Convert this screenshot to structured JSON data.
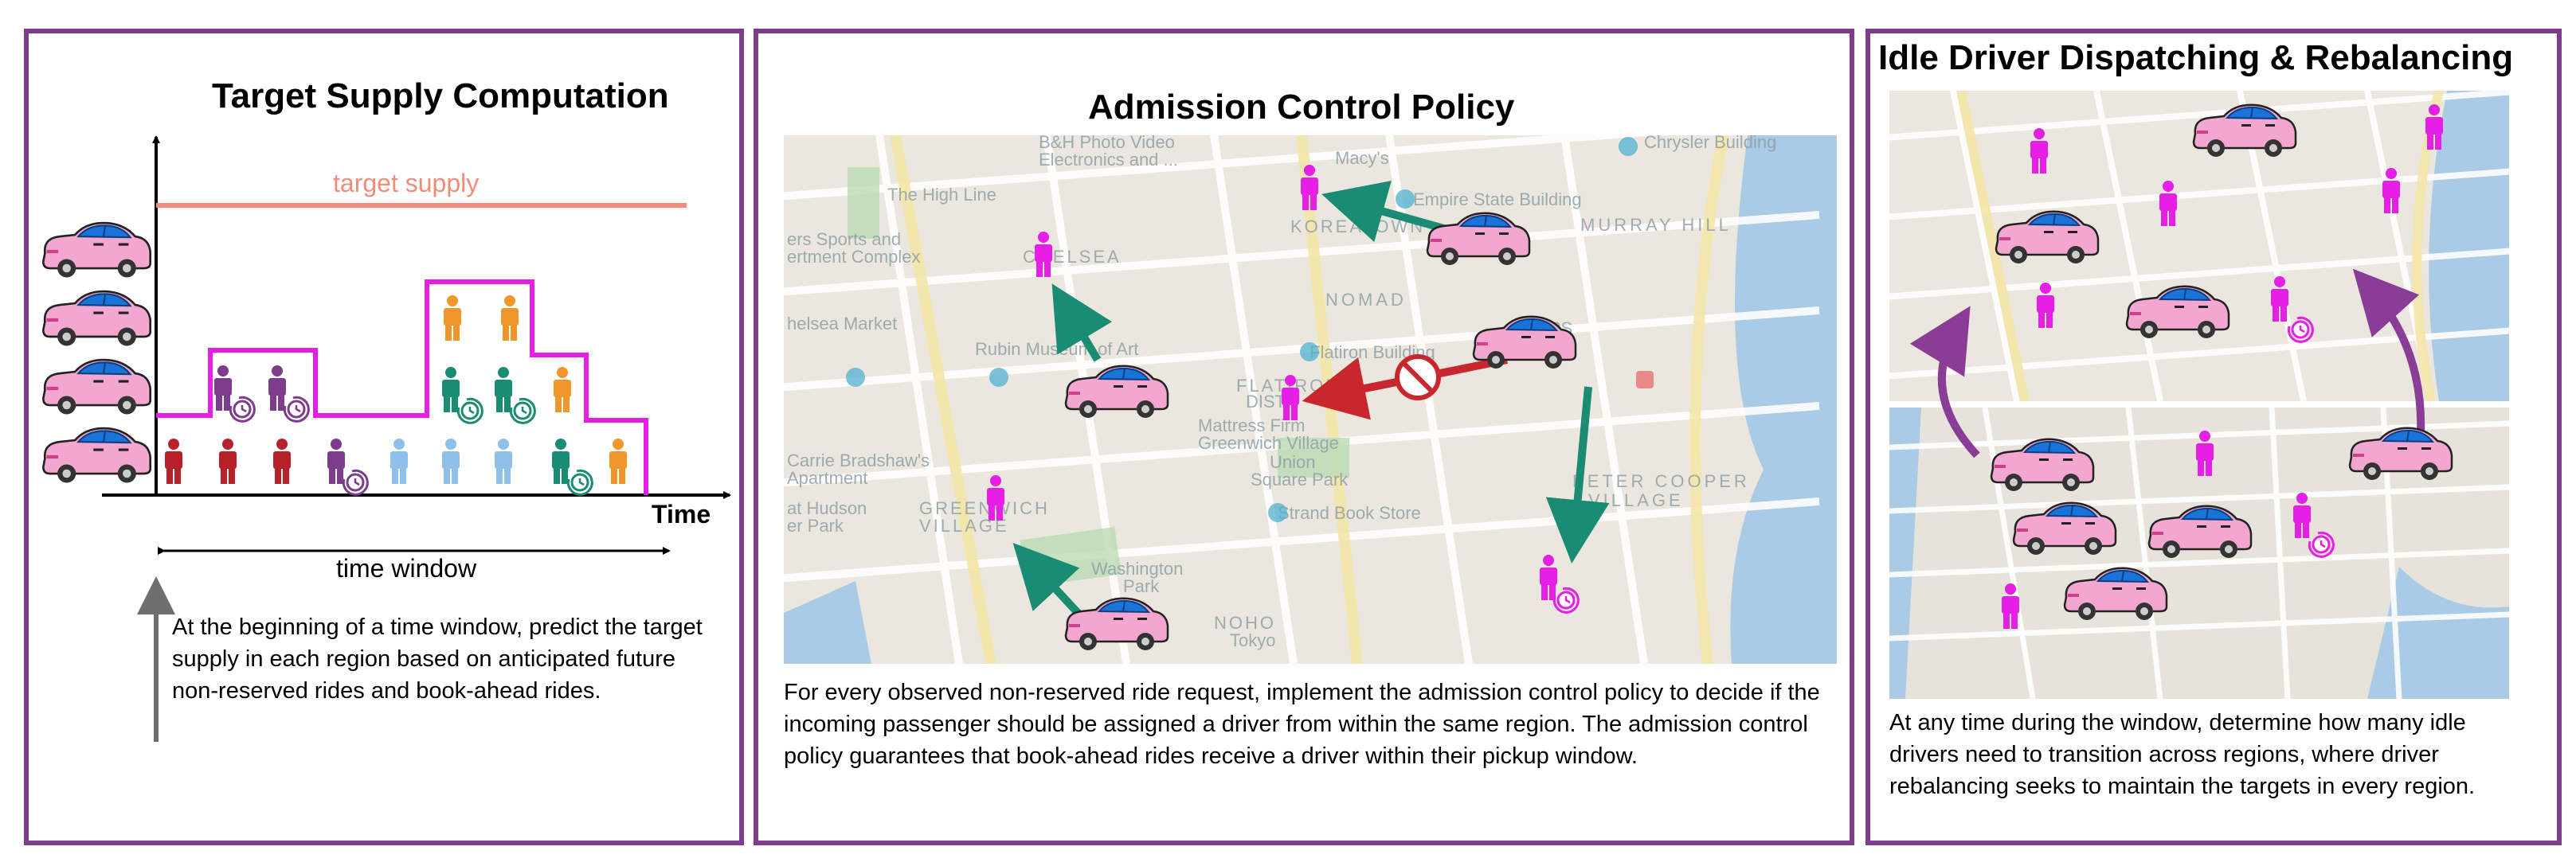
{
  "panels": {
    "target_supply": {
      "title": "Target Supply Computation",
      "target_label": "target supply",
      "time_label": "Time",
      "window_label": "time window",
      "description": "At the beginning of a time window, predict the target supply in each region based on anticipated future non-reserved rides and book-ahead rides."
    },
    "admission": {
      "title": "Admission Control Policy",
      "description": "For every observed non-reserved ride request, implement the admission control policy to decide if the incoming passenger should be assigned a driver from within the same region. The admission control policy guarantees that book-ahead rides receive a driver within their pickup window."
    },
    "dispatch": {
      "title": "Idle Driver Dispatching & Rebalancing",
      "description": "At any time during the window, determine how many idle drivers need to transition across regions, where driver rebalancing seeks to maintain the targets in every region."
    }
  },
  "map_labels": [
    "B&H Photo Video",
    "Electronics and ...",
    "Macy's",
    "Empire State Building",
    "Chrysler Building",
    "The High Line",
    "KOREATOWN",
    "MURRAY HILL",
    "ers Sports and",
    "ertment Complex",
    "CHELSEA",
    "NOMAD",
    "helsea Market",
    "Rubin Museum of Art",
    "Flatiron Building",
    "FLATIRON",
    "DISTR",
    "KIPS",
    "Mattress Firm",
    "Greenwich Village",
    "Union",
    "Square Park",
    "Carrie Bradshaw's",
    "Apartment",
    "GREENWICH",
    "VILLAGE",
    "Strand Book Store",
    "PETER COOPER",
    "VILLAGE",
    "at Hudson",
    "er Park",
    "Washington",
    "Park",
    "NOHO",
    "Tokyo"
  ],
  "colors": {
    "panel_border": "#7d3c8c",
    "target_line": "#f08c7c",
    "supply_outline": "#e61ee6",
    "car_pink": "#f2a6d0",
    "car_blue": "#1a73d9",
    "passenger_magenta": "#e61ee6",
    "arrow_green": "#1a8c74",
    "arrow_red": "#c8282d",
    "arrow_purple": "#8a3d96",
    "person_red": "#b8202a",
    "person_purple": "#7d3c8c",
    "person_lightblue": "#8ec0ea",
    "person_teal": "#1a8c74",
    "person_orange": "#f0962a"
  },
  "icons": [
    "car-icon",
    "passenger-icon",
    "clock-icon",
    "no-entry-icon",
    "map-pin-icon"
  ]
}
